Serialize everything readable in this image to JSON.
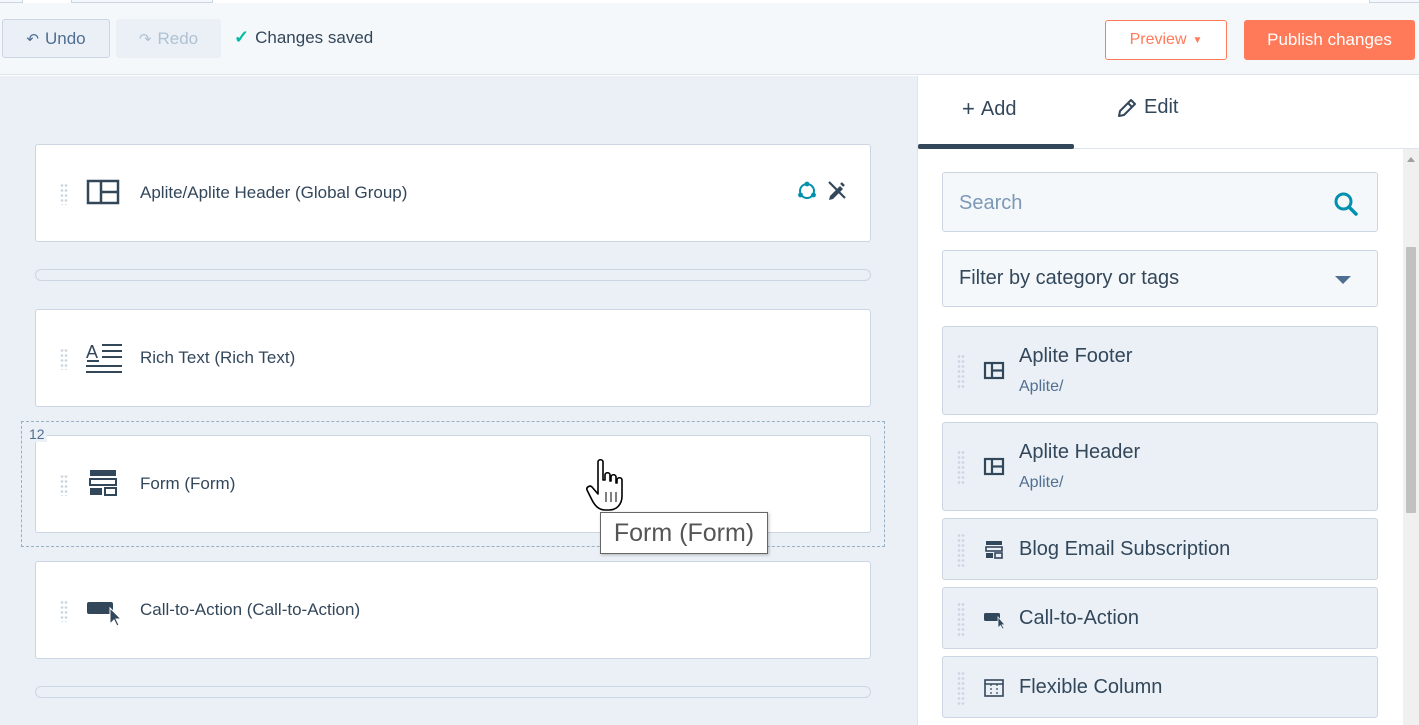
{
  "toolbar": {
    "undo_label": "Undo",
    "redo_label": "Redo",
    "status_text": "Changes saved",
    "preview_label": "Preview",
    "publish_label": "Publish changes"
  },
  "canvas": {
    "modules": [
      {
        "label": "Aplite/Aplite Header (Global Group)",
        "icon": "layout-icon"
      },
      {
        "label": "Rich Text (Rich Text)",
        "icon": "rich-text-icon"
      },
      {
        "label": "Form (Form)",
        "icon": "form-icon"
      },
      {
        "label": "Call-to-Action (Call-to-Action)",
        "icon": "cta-icon"
      }
    ],
    "hover_index": "12",
    "tooltip_text": "Form (Form)"
  },
  "panel": {
    "tabs": [
      {
        "label": "Add",
        "icon": "plus-icon",
        "active": true
      },
      {
        "label": "Edit",
        "icon": "pencil-icon",
        "active": false
      }
    ],
    "search_placeholder": "Search",
    "filter_label": "Filter by category or tags",
    "module_list": [
      {
        "title": "Aplite Footer",
        "subtitle": "Aplite/",
        "icon": "layout-icon"
      },
      {
        "title": "Aplite Header",
        "subtitle": "Aplite/",
        "icon": "layout-icon"
      },
      {
        "title": "Blog Email Subscription",
        "icon": "form-icon"
      },
      {
        "title": "Call-to-Action",
        "icon": "cta-icon"
      },
      {
        "title": "Flexible Column",
        "icon": "flexible-column-icon"
      }
    ]
  },
  "colors": {
    "accent": "#ff7a59",
    "success": "#00bda5",
    "text": "#33475b",
    "canvas_bg": "#eaf0f6"
  }
}
